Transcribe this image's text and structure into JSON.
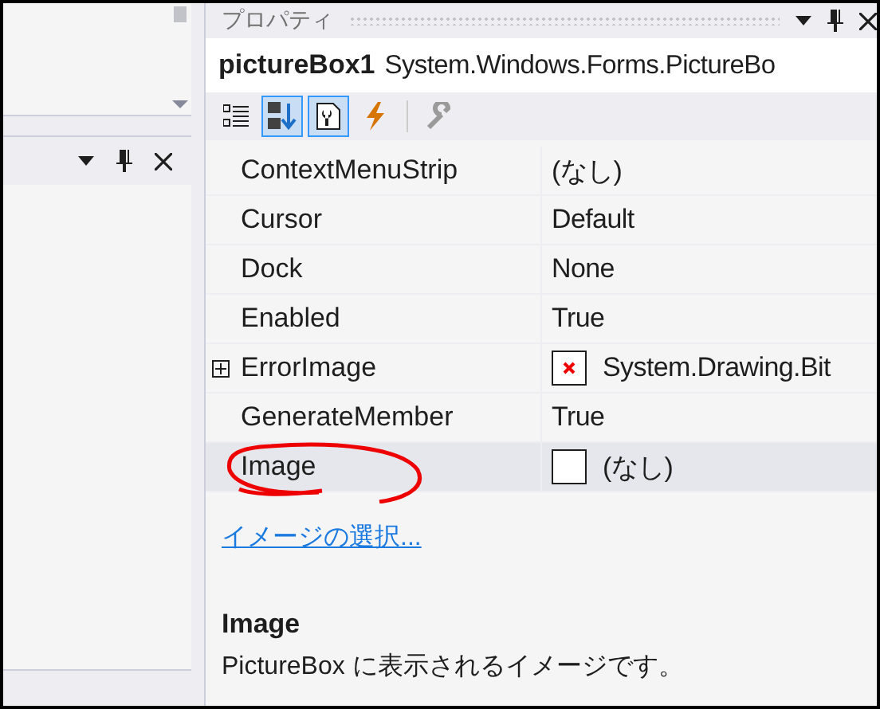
{
  "properties": {
    "title": "プロパティ",
    "object": {
      "name": "pictureBox1",
      "type": "System.Windows.Forms.PictureBo"
    },
    "toolbar": [
      {
        "kind": "categorized",
        "selected": false
      },
      {
        "kind": "alphabetical",
        "selected": true
      },
      {
        "kind": "properties",
        "selected": true
      },
      {
        "kind": "events",
        "selected": false
      },
      {
        "kind": "property-pages",
        "selected": false
      }
    ],
    "rows": [
      {
        "name": "ContextMenuStrip",
        "value": "(なし)",
        "kind": "text",
        "expandable": false,
        "selected": false
      },
      {
        "name": "Cursor",
        "value": "Default",
        "kind": "text",
        "expandable": false,
        "selected": false
      },
      {
        "name": "Dock",
        "value": "None",
        "kind": "text",
        "expandable": false,
        "selected": false
      },
      {
        "name": "Enabled",
        "value": "True",
        "kind": "text",
        "expandable": false,
        "selected": false
      },
      {
        "name": "ErrorImage",
        "value": "System.Drawing.Bit",
        "kind": "error-image",
        "expandable": true,
        "selected": false
      },
      {
        "name": "GenerateMember",
        "value": "True",
        "kind": "text",
        "expandable": false,
        "selected": false
      },
      {
        "name": "Image",
        "value": "(なし)",
        "kind": "image",
        "expandable": false,
        "selected": true
      }
    ],
    "command_link": "イメージの選択...",
    "description": {
      "title": "Image",
      "text": "PictureBox に表示されるイメージです。"
    }
  }
}
